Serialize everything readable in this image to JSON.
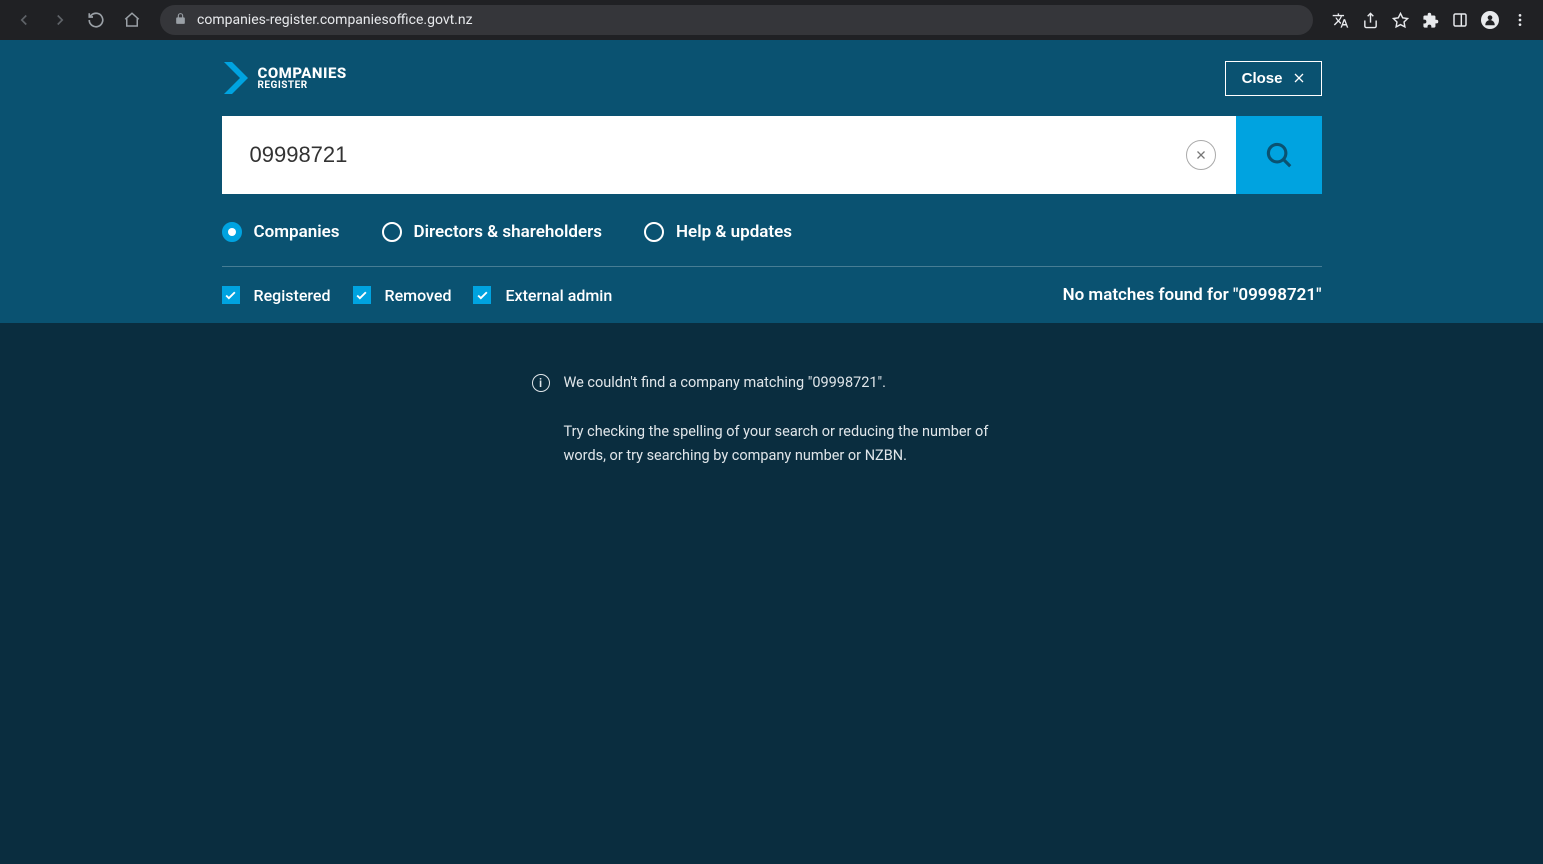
{
  "browser": {
    "url": "companies-register.companiesoffice.govt.nz"
  },
  "logo": {
    "title": "COMPANIES",
    "subtitle": "REGISTER"
  },
  "close_label": "Close",
  "search": {
    "value": "09998721"
  },
  "radios": [
    {
      "label": "Companies",
      "selected": true
    },
    {
      "label": "Directors & shareholders",
      "selected": false
    },
    {
      "label": "Help & updates",
      "selected": false
    }
  ],
  "filters": [
    {
      "label": "Registered",
      "checked": true
    },
    {
      "label": "Removed",
      "checked": true
    },
    {
      "label": "External admin",
      "checked": true
    }
  ],
  "result_status": "No matches found for \"09998721\"",
  "no_results": {
    "headline": "We couldn't find a company matching \"09998721\".",
    "body": "Try checking the spelling of your search or reducing the number of words, or try searching by company number or NZBN."
  }
}
